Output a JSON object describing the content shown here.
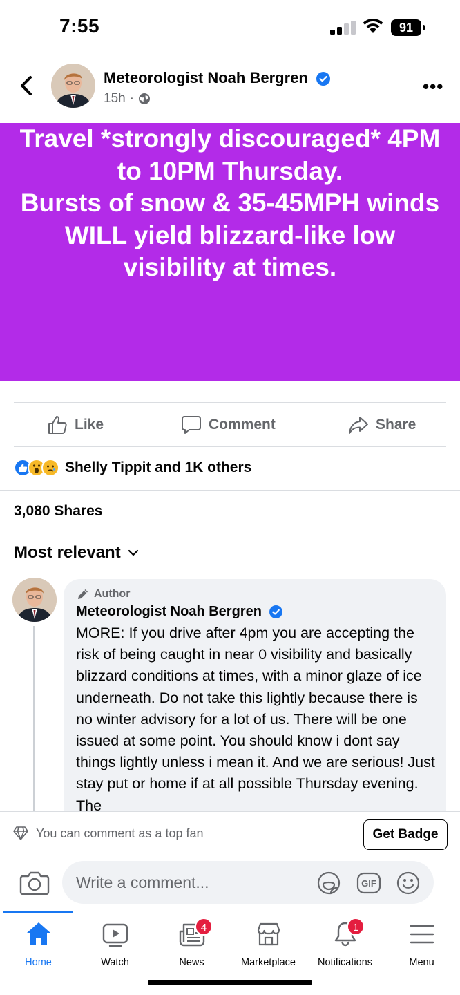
{
  "status_bar": {
    "time": "7:55",
    "battery": "91"
  },
  "post": {
    "author": "Meteorologist Noah Bergren",
    "age": "15h",
    "separator": "·",
    "more": "•••",
    "banner_text": "Travel *strongly discouraged* 4PM to 10PM Thursday.\nBursts of snow & 35-45MPH winds WILL yield blizzard-like low visibility at times.",
    "banner_color": "#b32be8"
  },
  "actions": {
    "like": "Like",
    "comment": "Comment",
    "share": "Share"
  },
  "reactions": {
    "text": "Shelly Tippit and 1K others"
  },
  "shares": "3,080 Shares",
  "sort": {
    "label": "Most relevant"
  },
  "comment": {
    "badge": "Author",
    "author": "Meteorologist Noah Bergren",
    "text": "MORE: If you drive after 4pm you are accepting the risk of being caught in near 0 visibility and basically blizzard conditions at times, with a minor glaze of ice underneath. Do not take this lightly because there is no winter advisory for a lot of us. There will be one issued at some point. You should know i dont say things lightly unless i mean it. And we are serious! Just stay put or home if at all possible Thursday evening. The"
  },
  "top_fan": {
    "text": "You can comment as a top fan",
    "button": "Get Badge"
  },
  "composer": {
    "placeholder": "Write a comment..."
  },
  "tabs": [
    {
      "label": "Home",
      "icon": "home-icon",
      "active": true
    },
    {
      "label": "Watch",
      "icon": "watch-icon"
    },
    {
      "label": "News",
      "icon": "news-icon",
      "badge": "4"
    },
    {
      "label": "Marketplace",
      "icon": "marketplace-icon"
    },
    {
      "label": "Notifications",
      "icon": "bell-icon",
      "badge": "1"
    },
    {
      "label": "Menu",
      "icon": "menu-icon"
    }
  ],
  "colors": {
    "accent": "#1877f2",
    "badge": "#e41e3f",
    "muted": "#65676b"
  }
}
